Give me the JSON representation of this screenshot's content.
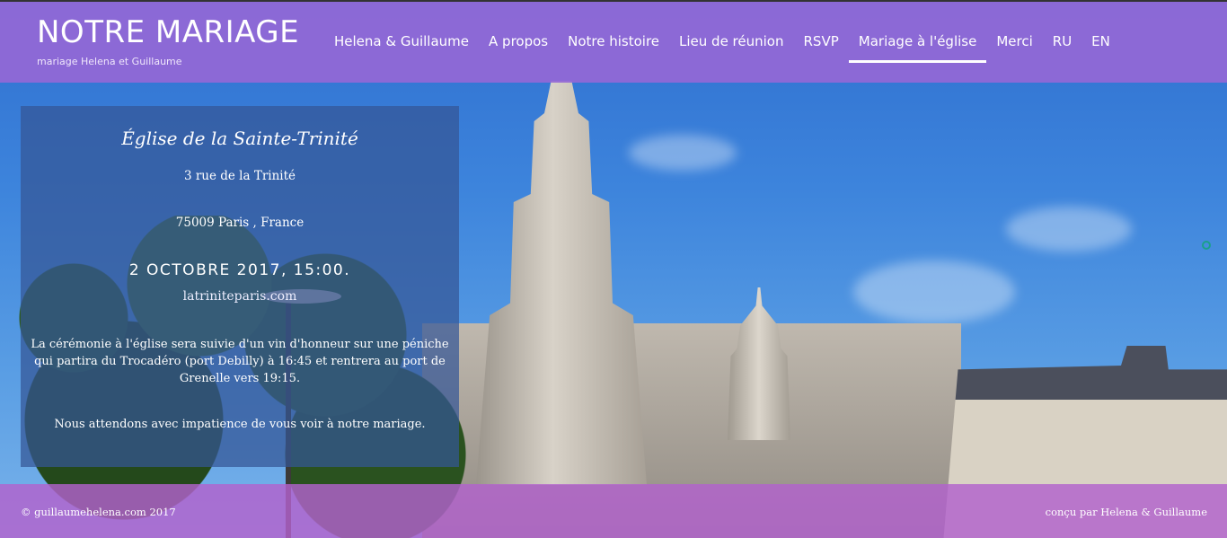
{
  "header": {
    "site_title": "NOTRE MARIAGE",
    "tagline": "mariage Helena et Guillaume",
    "nav": [
      {
        "label": "Helena & Guillaume"
      },
      {
        "label": "A propos"
      },
      {
        "label": "Notre histoire"
      },
      {
        "label": "Lieu de réunion"
      },
      {
        "label": "RSVP"
      },
      {
        "label": "Mariage à l'église",
        "active": true
      },
      {
        "label": "Merci"
      },
      {
        "label": "RU"
      },
      {
        "label": "EN"
      }
    ]
  },
  "venue": {
    "name": "Église de la Sainte-Trinité",
    "street": "3 rue de la Trinité",
    "city": "75009 Paris , France",
    "date": "2 OCTOBRE 2017, 15:00.",
    "website": "latriniteparis.com",
    "paragraph_1": "La cérémonie à l'église sera suivie d'un vin d'honneur sur une péniche qui partira du Trocadéro (port Debilly) à 16:45 et rentrera au port de Grenelle vers 19:15.",
    "paragraph_2": "Nous attendons avec impatience de vous voir à notre mariage."
  },
  "footer": {
    "copyright": "© guillaumehelena.com 2017",
    "credit": "conçu par Helena & Guillaume"
  },
  "colors": {
    "header_bg": "#9468d6",
    "panel_bg": "#345696",
    "footer_bg": "#b262cd",
    "scroll_indicator": "#1aa08a"
  }
}
